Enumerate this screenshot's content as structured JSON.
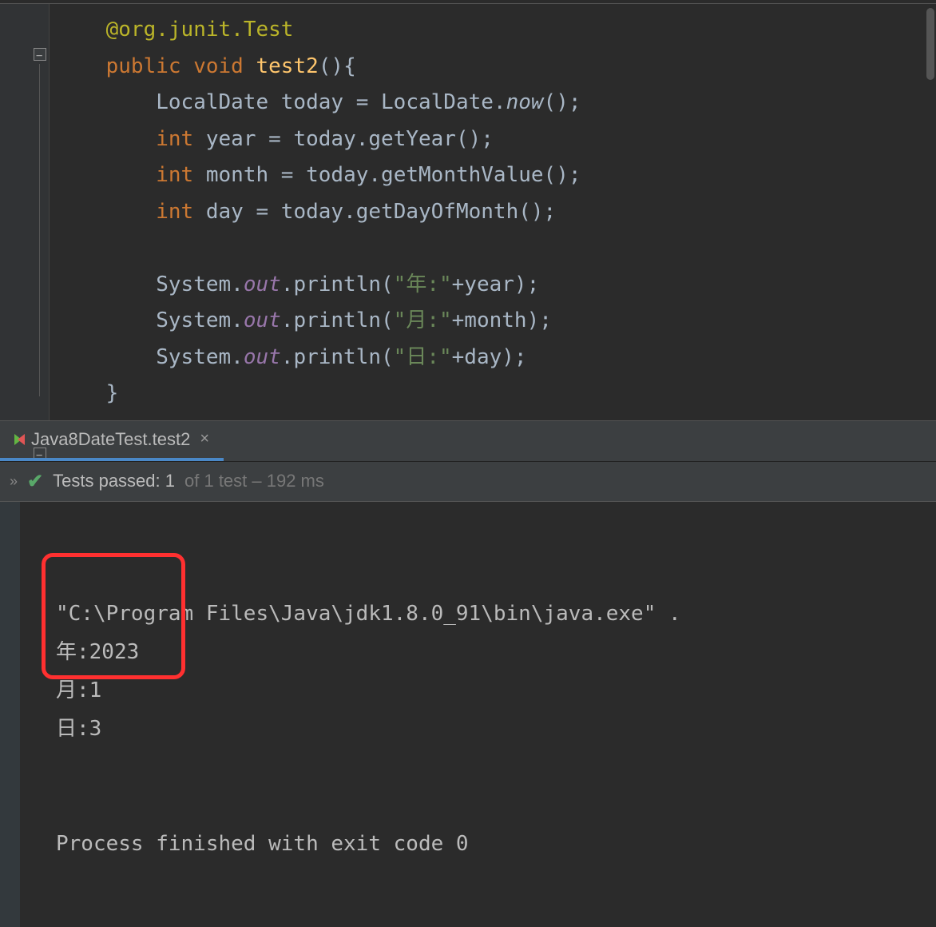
{
  "code": {
    "annotation_at": "@",
    "annotation_pkg": "org.junit.",
    "annotation_name": "Test",
    "kw_public": "public",
    "kw_void": "void",
    "method_name": "test2",
    "parens_open": "(){",
    "type_localdate": "LocalDate",
    "var_today": "today",
    "eq": " = ",
    "localdate_class": "LocalDate",
    "dot": ".",
    "now_method": "now",
    "call_end": "();",
    "kw_int": "int",
    "var_year": "year",
    "today_ref": "today",
    "getyear": "getYear",
    "var_month": "month",
    "getmonthvalue": "getMonthValue",
    "var_day": "day",
    "getdayofmonth": "getDayOfMonth",
    "system": "System",
    "out": "out",
    "println": "println",
    "paren_open": "(",
    "str_year": "\"年:\"",
    "plus": "+",
    "str_month": "\"月:\"",
    "str_day": "\"日:\"",
    "line_end": ");",
    "brace_close": "}"
  },
  "tab": {
    "label": "Java8DateTest.test2"
  },
  "status": {
    "passed_prefix": "Tests passed:",
    "passed_count": "1",
    "passed_suffix": "of 1 test – 192 ms"
  },
  "console": {
    "cmd": "\"C:\\Program Files\\Java\\jdk1.8.0_91\\bin\\java.exe\" .",
    "out_year": "年:2023",
    "out_month": "月:1",
    "out_day": "日:3",
    "exit": "Process finished with exit code 0"
  }
}
